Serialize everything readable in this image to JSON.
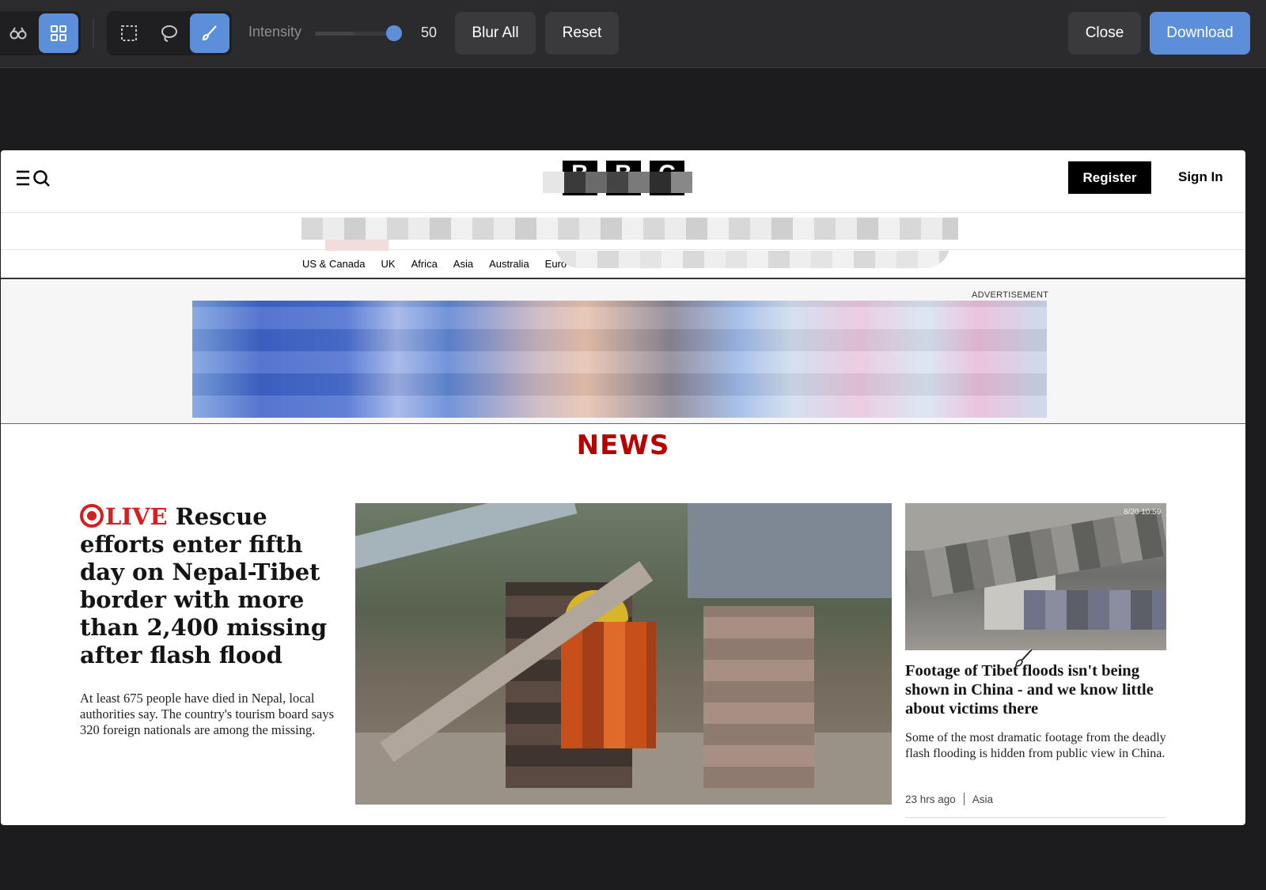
{
  "toolbar": {
    "icons": [
      "binoculars-icon",
      "grid-icon",
      "rect-select-icon",
      "lasso-icon",
      "brush-icon"
    ],
    "intensity_label": "Intensity",
    "intensity_value": "50",
    "intensity_fraction": 0.5,
    "blur_all_label": "Blur All",
    "reset_label": "Reset",
    "close_label": "Close",
    "download_label": "Download",
    "accent_color": "#5b8fd9"
  },
  "page": {
    "logo_letters": [
      "B",
      "B",
      "C"
    ],
    "register_label": "Register",
    "signin_label": "Sign In",
    "subnav": [
      "US & Canada",
      "UK",
      "Africa",
      "Asia",
      "Australia",
      "Euro"
    ],
    "ad_label": "ADVERTISEMENT",
    "section_title": "NEWS",
    "lead": {
      "live_label": "LIVE",
      "headline": "Rescue efforts enter fifth day on Nepal-Tibet border with more than 2,400 missing after flash flood",
      "summary": "At least 675 people have died in Nepal, local authorities say. The country's tourism board says 320 foreign nationals are among the missing."
    },
    "side": {
      "image_timestamp": "8/20 10:59",
      "headline": "Footage of Tibet floods isn't being shown in China - and we know little about victims there",
      "summary": "Some of the most dramatic footage from the deadly flash flooding is hidden from public view in China.",
      "time": "23 hrs ago",
      "region": "Asia"
    }
  }
}
